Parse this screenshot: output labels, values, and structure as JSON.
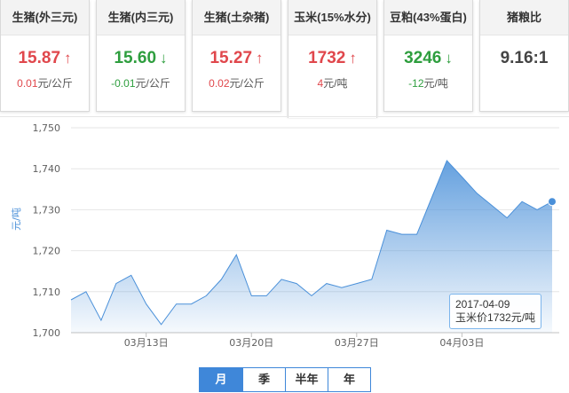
{
  "cards": [
    {
      "title": "生猪(外三元)",
      "value": "15.87",
      "trend": "up",
      "change": "0.01",
      "unit": "元/公斤"
    },
    {
      "title": "生猪(内三元)",
      "value": "15.60",
      "trend": "down",
      "change": "-0.01",
      "unit": "元/公斤"
    },
    {
      "title": "生猪(土杂猪)",
      "value": "15.27",
      "trend": "up",
      "change": "0.02",
      "unit": "元/公斤"
    },
    {
      "title": "玉米(15%水分)",
      "value": "1732",
      "trend": "up",
      "change": "4",
      "unit": "元/吨"
    },
    {
      "title": "豆粕(43%蛋白)",
      "value": "3246",
      "trend": "down",
      "change": "-12",
      "unit": "元/吨"
    },
    {
      "title": "猪粮比",
      "value": "9.16:1",
      "trend": "none",
      "change": "",
      "unit": ""
    }
  ],
  "active_card_index": 3,
  "colors": {
    "up": "#e0474c",
    "down": "#2e9e3e",
    "series": "#4a90d9",
    "accent": "#3f87d9"
  },
  "chart_data": {
    "type": "area",
    "ylabel": "元/吨",
    "ylim": [
      1700,
      1750
    ],
    "yticks": [
      "1,700",
      "1,710",
      "1,720",
      "1,730",
      "1,740",
      "1,750"
    ],
    "xtick_labels": [
      {
        "label": "03月13日",
        "x": "2017-03-13"
      },
      {
        "label": "03月20日",
        "x": "2017-03-20"
      },
      {
        "label": "03月27日",
        "x": "2017-03-27"
      },
      {
        "label": "04月03日",
        "x": "2017-04-03"
      }
    ],
    "grid": true,
    "series": [
      {
        "name": "玉米价",
        "x": [
          "2017-03-08",
          "2017-03-09",
          "2017-03-10",
          "2017-03-11",
          "2017-03-12",
          "2017-03-13",
          "2017-03-14",
          "2017-03-15",
          "2017-03-16",
          "2017-03-17",
          "2017-03-18",
          "2017-03-19",
          "2017-03-20",
          "2017-03-21",
          "2017-03-22",
          "2017-03-23",
          "2017-03-24",
          "2017-03-25",
          "2017-03-26",
          "2017-03-27",
          "2017-03-28",
          "2017-03-29",
          "2017-03-30",
          "2017-03-31",
          "2017-04-01",
          "2017-04-02",
          "2017-04-03",
          "2017-04-04",
          "2017-04-05",
          "2017-04-06",
          "2017-04-07",
          "2017-04-08",
          "2017-04-09"
        ],
        "values": [
          1708,
          1710,
          1703,
          1712,
          1714,
          1707,
          1702,
          1707,
          1707,
          1709,
          1713,
          1719,
          1709,
          1709,
          1713,
          1712,
          1709,
          1712,
          1711,
          1712,
          1713,
          1725,
          1724,
          1724,
          1733,
          1742,
          1738,
          1734,
          1731,
          1728,
          1732,
          1730,
          1732
        ]
      }
    ],
    "tooltip": {
      "date": "2017-04-09",
      "series_label": "玉米价",
      "value": "1732",
      "unit": "元/吨"
    }
  },
  "range_tabs": {
    "items": [
      "月",
      "季",
      "半年",
      "年"
    ],
    "selected": 0
  }
}
